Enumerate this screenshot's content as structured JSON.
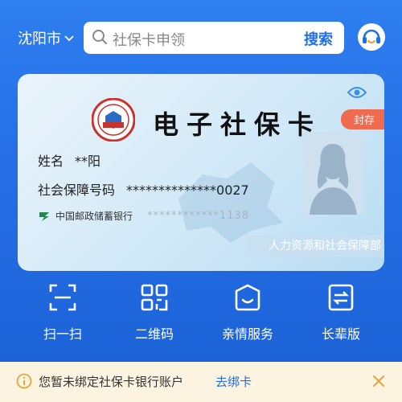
{
  "header": {
    "city": "沈阳市",
    "search_placeholder": "社保卡申领",
    "search_button": "搜索"
  },
  "card": {
    "title": "电子社保卡",
    "status_badge": "封存",
    "name_label": "姓名",
    "name_value": "**阳",
    "id_label": "社会保障号码",
    "id_value": "**************0027",
    "bank_name": "中国邮政储蓄银行",
    "bank_account": "************1138",
    "issuer": "人力资源和社会保障部"
  },
  "actions": [
    {
      "label": "扫一扫"
    },
    {
      "label": "二维码"
    },
    {
      "label": "亲情服务"
    },
    {
      "label": "长辈版"
    }
  ],
  "notice": {
    "text": "您暂未绑定社保卡银行账户",
    "link": "去绑卡"
  },
  "colors": {
    "primary": "#1f6fe8",
    "badge": "#ef6a4f",
    "notice_bg": "#fcf4e1",
    "notice_accent": "#e8a43a"
  }
}
